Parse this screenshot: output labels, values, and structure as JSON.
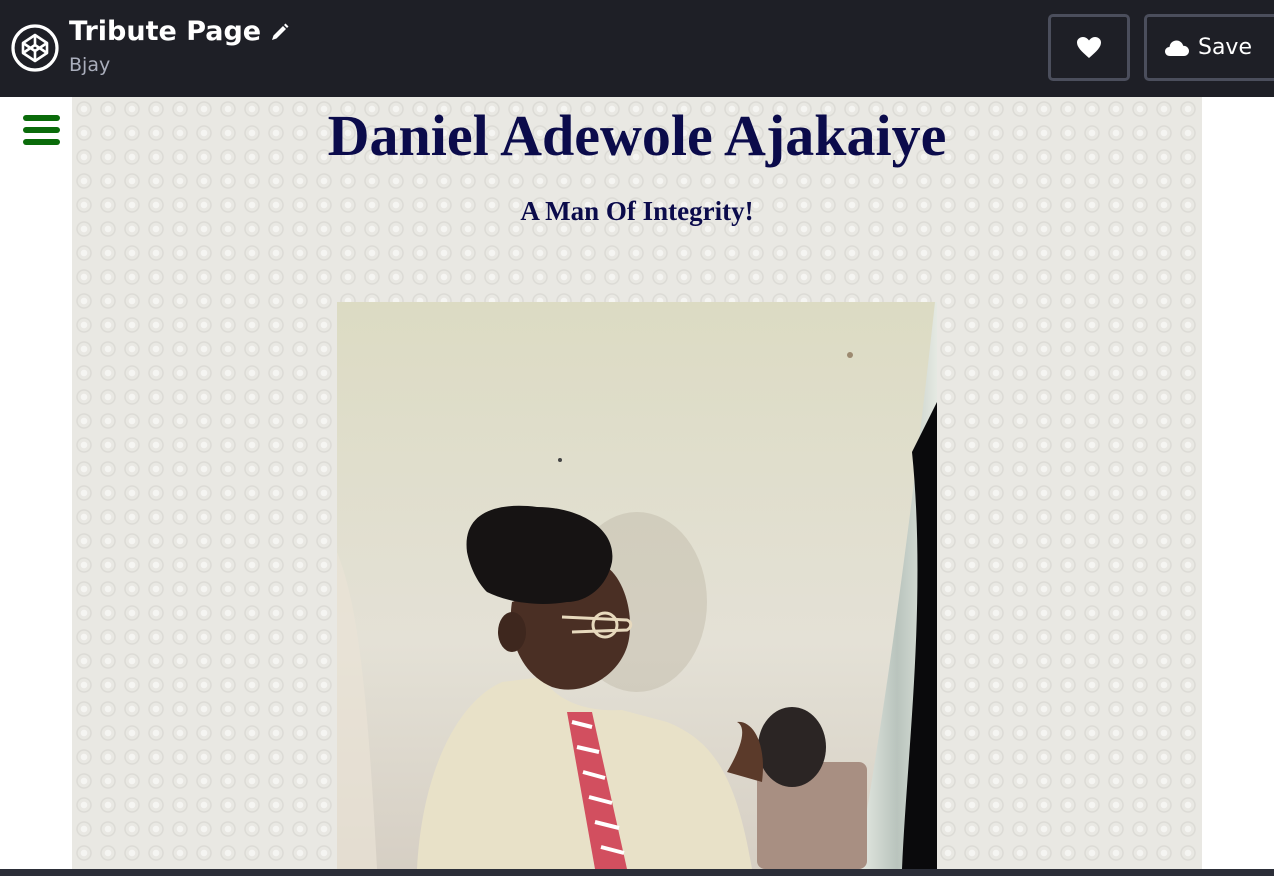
{
  "header": {
    "title": "Tribute Page",
    "author": "Bjay",
    "save_label": "Save"
  },
  "tribute": {
    "name": "Daniel Adewole Ajakaiye",
    "tagline": "A Man Of Integrity!"
  },
  "icons": {
    "logo": "codepen-logo-icon",
    "edit": "pencil-icon",
    "like": "heart-icon",
    "save": "cloud-icon",
    "menu": "hamburger-menu-icon"
  },
  "colors": {
    "topbar": "#1e1f26",
    "heading": "#0b0b4b",
    "menu": "#0a6b0a"
  }
}
